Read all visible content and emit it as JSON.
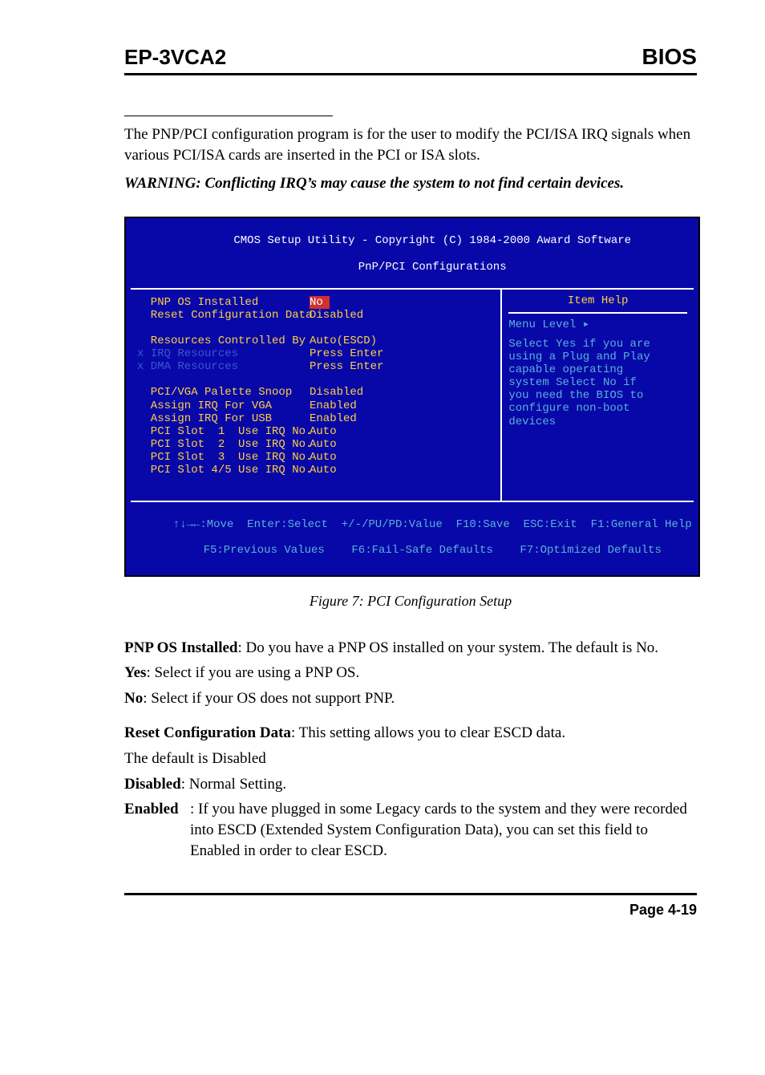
{
  "header": {
    "left": "EP-3VCA2",
    "right": "BIOS"
  },
  "intro": "The PNP/PCI configuration program is for the user to modify the PCI/ISA IRQ signals when various PCI/ISA cards are inserted in the PCI or ISA slots.",
  "warning": "WARNING: Conflicting IRQ’s may cause the system to not find certain devices.",
  "bios": {
    "title_line1": "CMOS Setup Utility - Copyright (C) 1984-2000 Award Software",
    "title_line2": "PnP/PCI Configurations",
    "rows": [
      {
        "marker": " ",
        "label": "PNP OS Installed",
        "value": "No",
        "selected": true,
        "dim": false
      },
      {
        "marker": " ",
        "label": "Reset Configuration Data",
        "value": "Disabled",
        "selected": false,
        "dim": false
      },
      {
        "marker": " ",
        "label": "",
        "value": "",
        "selected": false,
        "dim": false
      },
      {
        "marker": " ",
        "label": "Resources Controlled By",
        "value": "Auto(ESCD)",
        "selected": false,
        "dim": false
      },
      {
        "marker": "x",
        "label": "IRQ Resources",
        "value": "Press Enter",
        "selected": false,
        "dim": true
      },
      {
        "marker": "x",
        "label": "DMA Resources",
        "value": "Press Enter",
        "selected": false,
        "dim": true
      },
      {
        "marker": " ",
        "label": "",
        "value": "",
        "selected": false,
        "dim": false
      },
      {
        "marker": " ",
        "label": "PCI/VGA Palette Snoop",
        "value": "Disabled",
        "selected": false,
        "dim": false
      },
      {
        "marker": " ",
        "label": "Assign IRQ For VGA",
        "value": "Enabled",
        "selected": false,
        "dim": false
      },
      {
        "marker": " ",
        "label": "Assign IRQ For USB",
        "value": "Enabled",
        "selected": false,
        "dim": false
      },
      {
        "marker": " ",
        "label": "PCI Slot  1  Use IRQ No.",
        "value": "Auto",
        "selected": false,
        "dim": false
      },
      {
        "marker": " ",
        "label": "PCI Slot  2  Use IRQ No.",
        "value": "Auto",
        "selected": false,
        "dim": false
      },
      {
        "marker": " ",
        "label": "PCI Slot  3  Use IRQ No.",
        "value": "Auto",
        "selected": false,
        "dim": false
      },
      {
        "marker": " ",
        "label": "PCI Slot 4/5 Use IRQ No.",
        "value": "Auto",
        "selected": false,
        "dim": false
      }
    ],
    "help_title": "Item Help",
    "menu_level": "Menu Level   ▸",
    "help_text": "Select Yes if you are\nusing a Plug and Play\ncapable operating\nsystem Select No if\nyou need the BIOS to\nconfigure non-boot\ndevices",
    "footer_line1": "↑↓→←:Move  Enter:Select  +/-/PU/PD:Value  F10:Save  ESC:Exit  F1:General Help",
    "footer_line2": "F5:Previous Values    F6:Fail-Safe Defaults    F7:Optimized Defaults"
  },
  "caption": "Figure 7:  PCI Configuration Setup",
  "descriptions": {
    "pnp_title": "PNP OS Installed",
    "pnp_body": ": Do you have a PNP OS installed on  your system. The default is No.",
    "yes_label": "Yes",
    "yes_body": ":  Select if you are using a PNP OS.",
    "no_label": "No",
    "no_body": ":   Select if your OS does not support PNP.",
    "reset_title": "Reset Configuration Data",
    "reset_body": ": This setting allows you to clear ESCD data.",
    "reset_default": "The default is Disabled",
    "disabled_label": "Disabled",
    "disabled_body": ": Normal Setting.",
    "enabled_label": "Enabled",
    "enabled_body": ":  If you have plugged in some Legacy cards to the system and they were recorded into ESCD (Extended System Configuration Data), you can set this field to Enabled in order to clear ESCD."
  },
  "page_number": "Page 4-19"
}
